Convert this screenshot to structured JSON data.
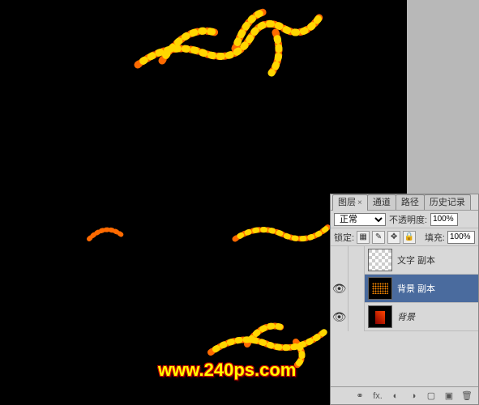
{
  "tabs": {
    "layers": "图层",
    "channels": "通道",
    "paths": "路径",
    "history": "历史记录"
  },
  "blend": {
    "mode": "正常",
    "opacity_label": "不透明度:",
    "opacity_value": "100%"
  },
  "lock": {
    "label": "锁定:",
    "fill_label": "填充:",
    "fill_value": "100%"
  },
  "layers_list": [
    {
      "name": "文字 副本",
      "visible": false,
      "selected": false,
      "thumb": "checker"
    },
    {
      "name": "背景 副本",
      "visible": true,
      "selected": true,
      "thumb": "dark"
    },
    {
      "name": "背景",
      "visible": true,
      "selected": false,
      "thumb": "dark2"
    }
  ],
  "watermark": "www.240ps.com",
  "footer_icons": {
    "link": "link",
    "fx": "fx.",
    "mask": "mask",
    "adjust": "adjust",
    "folder": "folder",
    "new": "new",
    "trash": "trash"
  }
}
